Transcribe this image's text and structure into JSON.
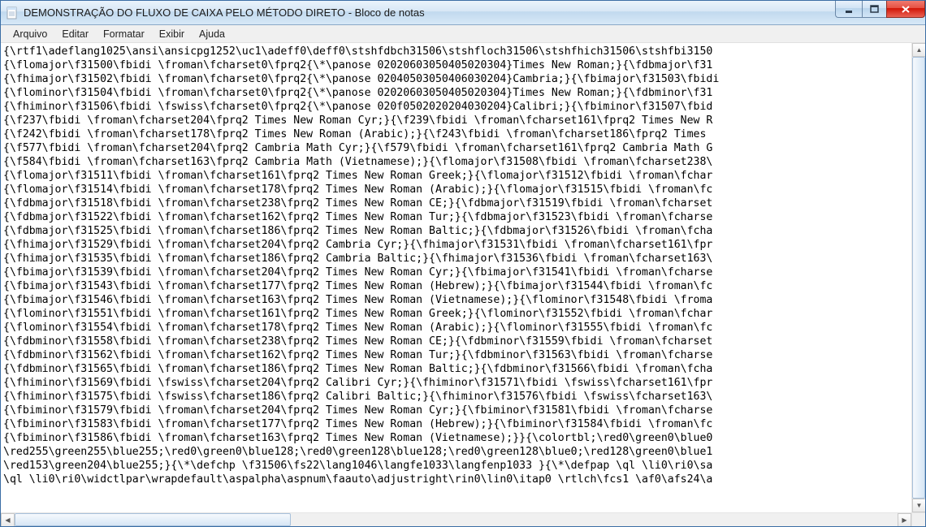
{
  "window": {
    "title": "DEMONSTRAÇÃO DO FLUXO DE CAIXA PELO MÉTODO DIRETO - Bloco de notas"
  },
  "menu": {
    "file": "Arquivo",
    "edit": "Editar",
    "format": "Formatar",
    "view": "Exibir",
    "help": "Ajuda"
  },
  "content_lines": [
    "{\\rtf1\\adeflang1025\\ansi\\ansicpg1252\\uc1\\adeff0\\deff0\\stshfdbch31506\\stshfloch31506\\stshfhich31506\\stshfbi3150",
    "{\\flomajor\\f31500\\fbidi \\froman\\fcharset0\\fprq2{\\*\\panose 02020603050405020304}Times New Roman;}{\\fdbmajor\\f31",
    "{\\fhimajor\\f31502\\fbidi \\froman\\fcharset0\\fprq2{\\*\\panose 02040503050406030204}Cambria;}{\\fbimajor\\f31503\\fbidi",
    "{\\flominor\\f31504\\fbidi \\froman\\fcharset0\\fprq2{\\*\\panose 02020603050405020304}Times New Roman;}{\\fdbminor\\f31",
    "{\\fhiminor\\f31506\\fbidi \\fswiss\\fcharset0\\fprq2{\\*\\panose 020f0502020204030204}Calibri;}{\\fbiminor\\f31507\\fbid",
    "{\\f237\\fbidi \\froman\\fcharset204\\fprq2 Times New Roman Cyr;}{\\f239\\fbidi \\froman\\fcharset161\\fprq2 Times New R",
    "{\\f242\\fbidi \\froman\\fcharset178\\fprq2 Times New Roman (Arabic);}{\\f243\\fbidi \\froman\\fcharset186\\fprq2 Times ",
    "{\\f577\\fbidi \\froman\\fcharset204\\fprq2 Cambria Math Cyr;}{\\f579\\fbidi \\froman\\fcharset161\\fprq2 Cambria Math G",
    "{\\f584\\fbidi \\froman\\fcharset163\\fprq2 Cambria Math (Vietnamese);}{\\flomajor\\f31508\\fbidi \\froman\\fcharset238\\",
    "{\\flomajor\\f31511\\fbidi \\froman\\fcharset161\\fprq2 Times New Roman Greek;}{\\flomajor\\f31512\\fbidi \\froman\\fchar",
    "{\\flomajor\\f31514\\fbidi \\froman\\fcharset178\\fprq2 Times New Roman (Arabic);}{\\flomajor\\f31515\\fbidi \\froman\\fc",
    "{\\fdbmajor\\f31518\\fbidi \\froman\\fcharset238\\fprq2 Times New Roman CE;}{\\fdbmajor\\f31519\\fbidi \\froman\\fcharset",
    "{\\fdbmajor\\f31522\\fbidi \\froman\\fcharset162\\fprq2 Times New Roman Tur;}{\\fdbmajor\\f31523\\fbidi \\froman\\fcharse",
    "{\\fdbmajor\\f31525\\fbidi \\froman\\fcharset186\\fprq2 Times New Roman Baltic;}{\\fdbmajor\\f31526\\fbidi \\froman\\fcha",
    "{\\fhimajor\\f31529\\fbidi \\froman\\fcharset204\\fprq2 Cambria Cyr;}{\\fhimajor\\f31531\\fbidi \\froman\\fcharset161\\fpr",
    "{\\fhimajor\\f31535\\fbidi \\froman\\fcharset186\\fprq2 Cambria Baltic;}{\\fhimajor\\f31536\\fbidi \\froman\\fcharset163\\",
    "{\\fbimajor\\f31539\\fbidi \\froman\\fcharset204\\fprq2 Times New Roman Cyr;}{\\fbimajor\\f31541\\fbidi \\froman\\fcharse",
    "{\\fbimajor\\f31543\\fbidi \\froman\\fcharset177\\fprq2 Times New Roman (Hebrew);}{\\fbimajor\\f31544\\fbidi \\froman\\fc",
    "{\\fbimajor\\f31546\\fbidi \\froman\\fcharset163\\fprq2 Times New Roman (Vietnamese);}{\\flominor\\f31548\\fbidi \\froma",
    "{\\flominor\\f31551\\fbidi \\froman\\fcharset161\\fprq2 Times New Roman Greek;}{\\flominor\\f31552\\fbidi \\froman\\fchar",
    "{\\flominor\\f31554\\fbidi \\froman\\fcharset178\\fprq2 Times New Roman (Arabic);}{\\flominor\\f31555\\fbidi \\froman\\fc",
    "{\\fdbminor\\f31558\\fbidi \\froman\\fcharset238\\fprq2 Times New Roman CE;}{\\fdbminor\\f31559\\fbidi \\froman\\fcharset",
    "{\\fdbminor\\f31562\\fbidi \\froman\\fcharset162\\fprq2 Times New Roman Tur;}{\\fdbminor\\f31563\\fbidi \\froman\\fcharse",
    "{\\fdbminor\\f31565\\fbidi \\froman\\fcharset186\\fprq2 Times New Roman Baltic;}{\\fdbminor\\f31566\\fbidi \\froman\\fcha",
    "{\\fhiminor\\f31569\\fbidi \\fswiss\\fcharset204\\fprq2 Calibri Cyr;}{\\fhiminor\\f31571\\fbidi \\fswiss\\fcharset161\\fpr",
    "{\\fhiminor\\f31575\\fbidi \\fswiss\\fcharset186\\fprq2 Calibri Baltic;}{\\fhiminor\\f31576\\fbidi \\fswiss\\fcharset163\\",
    "{\\fbiminor\\f31579\\fbidi \\froman\\fcharset204\\fprq2 Times New Roman Cyr;}{\\fbiminor\\f31581\\fbidi \\froman\\fcharse",
    "{\\fbiminor\\f31583\\fbidi \\froman\\fcharset177\\fprq2 Times New Roman (Hebrew);}{\\fbiminor\\f31584\\fbidi \\froman\\fc",
    "{\\fbiminor\\f31586\\fbidi \\froman\\fcharset163\\fprq2 Times New Roman (Vietnamese);}}{\\colortbl;\\red0\\green0\\blue0",
    "\\red255\\green255\\blue255;\\red0\\green0\\blue128;\\red0\\green128\\blue128;\\red0\\green128\\blue0;\\red128\\green0\\blue1",
    "\\red153\\green204\\blue255;}{\\*\\defchp \\f31506\\fs22\\lang1046\\langfe1033\\langfenp1033 }{\\*\\defpap \\ql \\li0\\ri0\\sa",
    "\\ql \\li0\\ri0\\widctlpar\\wrapdefault\\aspalpha\\aspnum\\faauto\\adjustright\\rin0\\lin0\\itap0 \\rtlch\\fcs1 \\af0\\afs24\\a"
  ]
}
